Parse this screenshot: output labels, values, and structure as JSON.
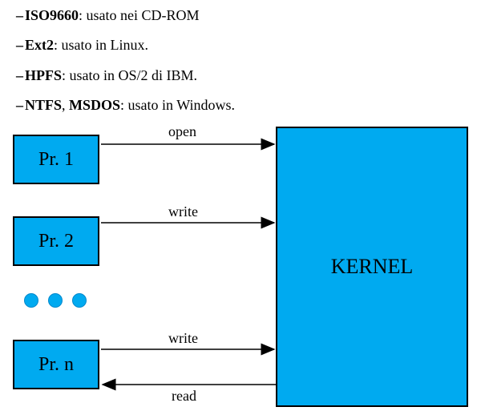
{
  "list": {
    "items": [
      {
        "bold": "ISO9660",
        "rest": ": usato nei CD-ROM"
      },
      {
        "bold": "Ext2",
        "rest": ": usato in Linux."
      },
      {
        "bold": "HPFS",
        "rest": ": usato in OS/2 di IBM."
      },
      {
        "bold": "NTFS",
        "rest": ", ",
        "bold2": "MSDOS",
        "rest2": ": usato in Windows."
      }
    ]
  },
  "diagram": {
    "proc1": "Pr. 1",
    "proc2": "Pr. 2",
    "procn": "Pr. n",
    "kernel": "KERNEL",
    "arrows": {
      "open": "open",
      "write1": "write",
      "write2": "write",
      "read": "read"
    }
  }
}
